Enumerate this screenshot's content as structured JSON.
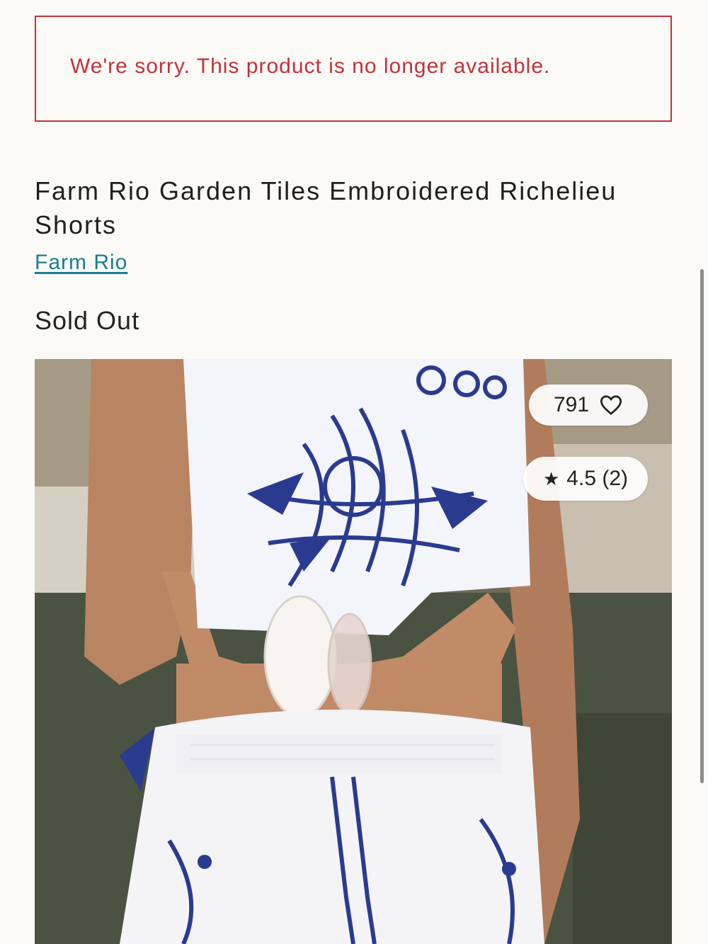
{
  "alert": {
    "message": "We're sorry. This product is no longer available."
  },
  "product": {
    "title": "Farm Rio Garden Tiles Embroidered Richelieu Shorts",
    "brand": "Farm Rio",
    "status": "Sold Out"
  },
  "photo": {
    "likes_count": "791",
    "rating_star": "★",
    "rating_text": "4.5 (2)"
  },
  "colors": {
    "alert": "#c1323a",
    "brand_link": "#1a7d93",
    "print_blue": "#2a3b8f"
  },
  "icons": {
    "heart": "heart-icon",
    "star": "star-icon"
  }
}
